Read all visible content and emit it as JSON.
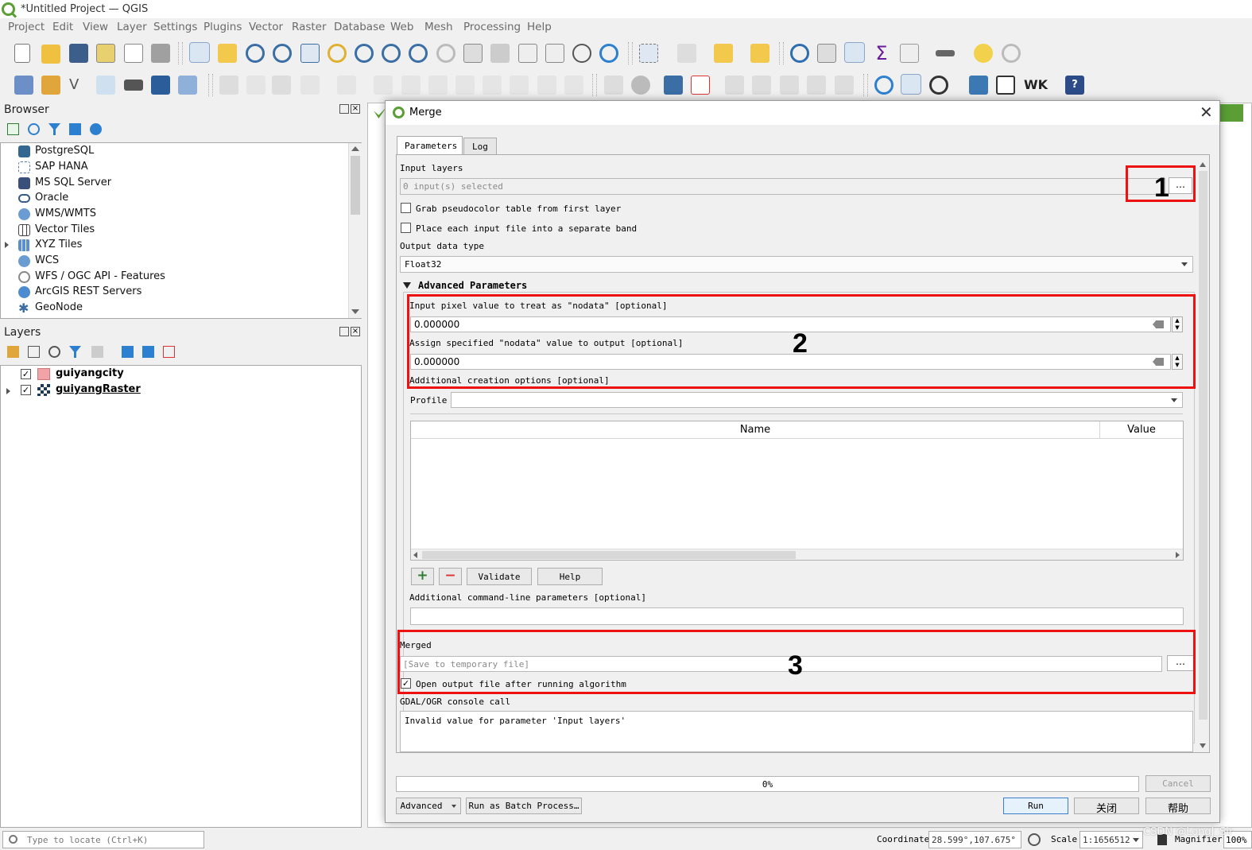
{
  "window": {
    "title": "*Untitled Project — QGIS"
  },
  "menu": [
    "Project",
    "Edit",
    "View",
    "Layer",
    "Settings",
    "Plugins",
    "Vector",
    "Raster",
    "Database",
    "Web",
    "Mesh",
    "Processing",
    "Help"
  ],
  "browser": {
    "title": "Browser",
    "items": [
      "PostgreSQL",
      "SAP HANA",
      "MS SQL Server",
      "Oracle",
      "WMS/WMTS",
      "Vector Tiles",
      "XYZ Tiles",
      "WCS",
      "WFS / OGC API - Features",
      "ArcGIS REST Servers",
      "GeoNode"
    ]
  },
  "layers": {
    "title": "Layers",
    "items": [
      {
        "name": "guiyangcity",
        "checked": true
      },
      {
        "name": "guiyangRaster",
        "checked": true
      }
    ]
  },
  "dialog": {
    "title": "Merge",
    "tabs": [
      "Parameters",
      "Log"
    ],
    "input_layers_label": "Input layers",
    "input_layers_value": "0 input(s) selected",
    "browse_label": "…",
    "grab_pseudocolor_label": "Grab pseudocolor table from first layer",
    "separate_band_label": "Place each input file into a separate band",
    "output_type_label": "Output data type",
    "output_type_value": "Float32",
    "advanced_title": "Advanced Parameters",
    "nodata_input_label": "Input pixel value to treat as \"nodata\" [optional]",
    "nodata_input_value": "0.000000",
    "nodata_output_label": "Assign specified \"nodata\" value to output [optional]",
    "nodata_output_value": "0.000000",
    "creation_options_label": "Additional creation options [optional]",
    "profile_label": "Profile",
    "table_headers": [
      "Name",
      "Value"
    ],
    "validate_label": "Validate",
    "help_label": "Help",
    "cmdline_label": "Additional command-line parameters [optional]",
    "merged_label": "Merged",
    "merged_placeholder": "[Save to temporary file]",
    "open_output_label": "Open output file after running algorithm",
    "console_label": "GDAL/OGR console call",
    "console_text": "Invalid value for parameter 'Input layers'",
    "progress_text": "0%",
    "progress_value": 0,
    "cancel_label": "Cancel",
    "advanced_button_label": "Advanced",
    "batch_label": "Run as Batch Process…",
    "run_label": "Run",
    "close_label": "关闭",
    "help_button_label": "帮助"
  },
  "annotations": [
    "1",
    "2",
    "3"
  ],
  "statusbar": {
    "locate_placeholder": "Type to locate (Ctrl+K)",
    "coordinate_label": "Coordinate",
    "coordinate_value": "28.599°,107.675°",
    "scale_label": "Scale",
    "scale_value": "1:1656512",
    "magnifier_label": "Magnifier",
    "magnifier_value": "100%",
    "watermark": "CSDN @LongJ_Sir"
  },
  "colors": {
    "highlight_red": "#ee1111",
    "qgis_green": "#5a9e35",
    "polygon_layer": "#f2a3a8"
  }
}
